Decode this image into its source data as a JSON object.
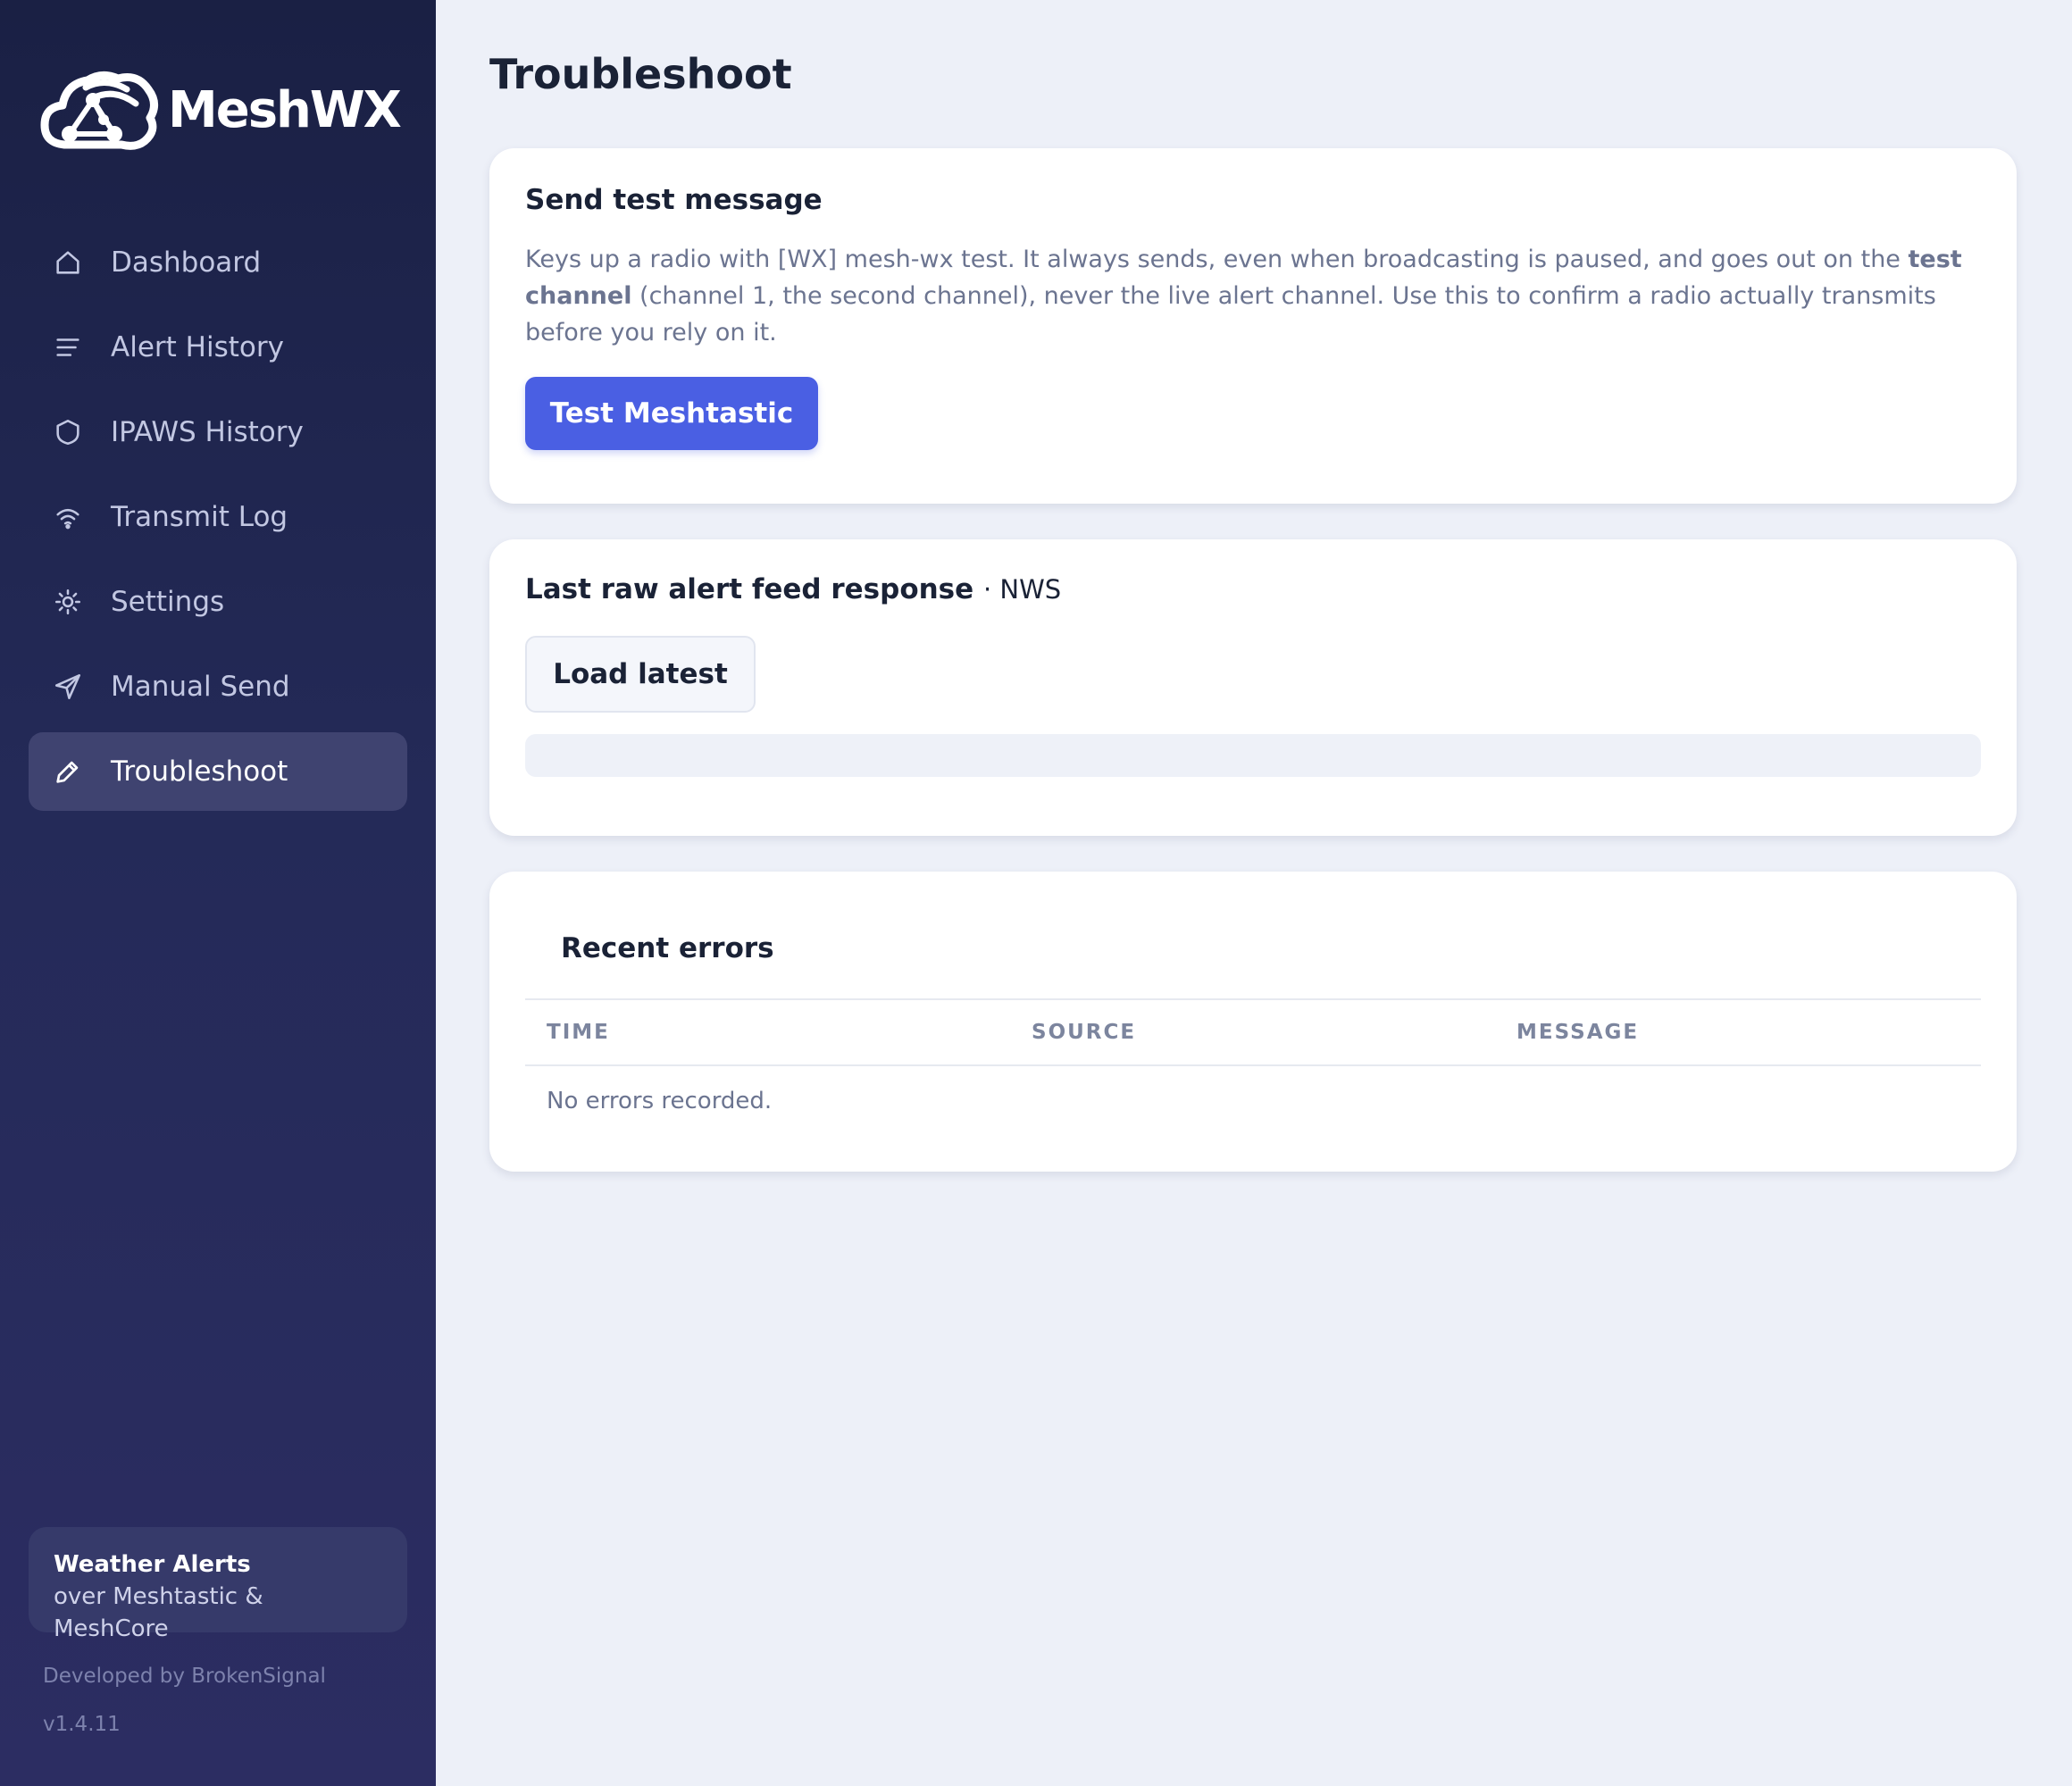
{
  "app": {
    "name": "MeshWX"
  },
  "sidebar": {
    "items": [
      {
        "label": "Dashboard",
        "icon": "home-icon"
      },
      {
        "label": "Alert History",
        "icon": "list-icon"
      },
      {
        "label": "IPAWS History",
        "icon": "shield-icon"
      },
      {
        "label": "Transmit Log",
        "icon": "wifi-icon"
      },
      {
        "label": "Settings",
        "icon": "gear-icon"
      },
      {
        "label": "Manual Send",
        "icon": "send-icon"
      },
      {
        "label": "Troubleshoot",
        "icon": "pencil-icon",
        "active": true
      }
    ],
    "promo_title": "Weather Alerts",
    "promo_sub": "over Meshtastic & MeshCore",
    "developer": "Developed by BrokenSignal",
    "version": "v1.4.11"
  },
  "page": {
    "title": "Troubleshoot"
  },
  "test_card": {
    "title": "Send test message",
    "desc_part1": "Keys up a radio with [WX] mesh-wx test. It always sends, even when broadcasting is paused, and goes out on the ",
    "desc_bold": "test channel",
    "desc_part2": " (channel 1, the second channel), never the live alert channel. Use this to confirm a radio actually transmits before you rely on it.",
    "button_label": "Test Meshtastic"
  },
  "feed_card": {
    "title": "Last raw alert feed response",
    "source": "· NWS",
    "button_label": "Load latest",
    "raw_output": ""
  },
  "errors_card": {
    "title": "Recent errors",
    "columns": [
      "TIME",
      "SOURCE",
      "MESSAGE"
    ],
    "empty_text": "No errors recorded."
  },
  "colors": {
    "sidebar_top": "#1a2044",
    "sidebar_bottom": "#2c2d62",
    "accent": "#4a5fe3",
    "background": "#edf0f8"
  }
}
